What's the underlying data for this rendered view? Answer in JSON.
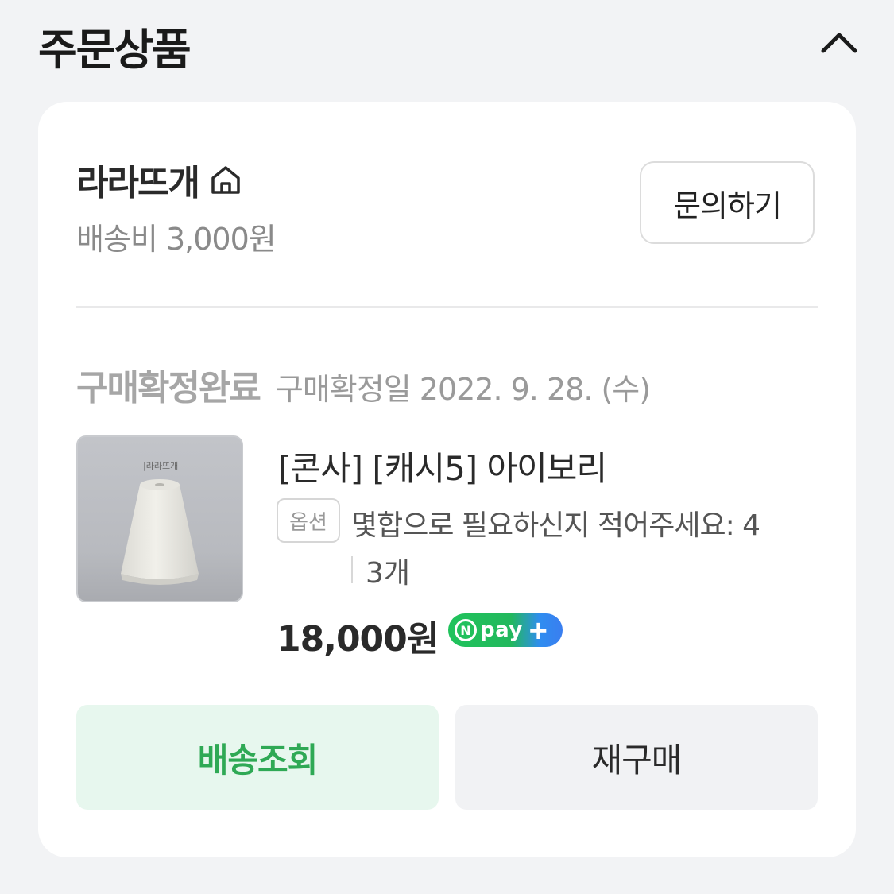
{
  "section": {
    "title": "주문상품"
  },
  "store": {
    "name": "라라뜨개",
    "shipping": "배송비 3,000원",
    "inquiry_label": "문의하기"
  },
  "order": {
    "status": "구매확정완료",
    "confirm_date": "구매확정일 2022. 9. 28. (수)"
  },
  "product": {
    "thumb_label": "|라라뜨개",
    "title": "[콘사] [캐시5] 아이보리",
    "option_badge": "옵션",
    "option_text": "몇합으로 필요하신지 적어주세요: 4",
    "quantity": "3개",
    "price": "18,000원",
    "npay": {
      "n": "N",
      "word": "pay",
      "plus": "+"
    }
  },
  "actions": {
    "track_label": "배송조회",
    "rebuy_label": "재구매"
  },
  "colors": {
    "background": "#f2f3f5",
    "accent_green": "#2fa955",
    "track_bg": "#e7f7ee"
  },
  "icons": [
    "chevron-up-icon",
    "home-icon"
  ]
}
